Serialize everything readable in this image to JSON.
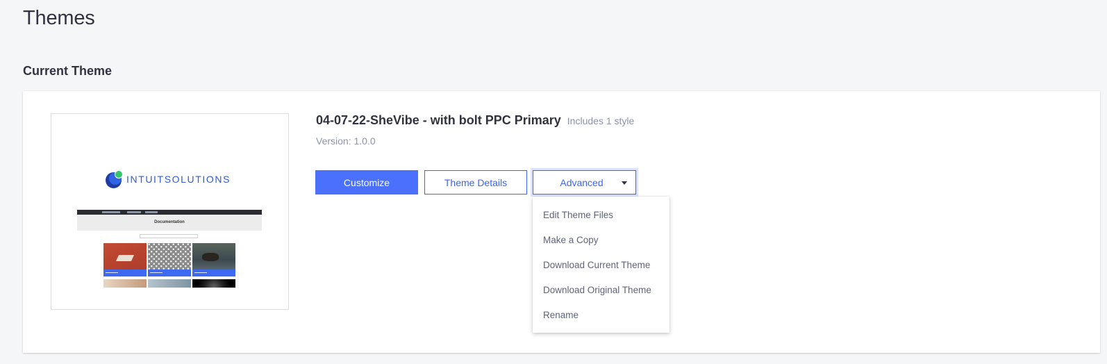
{
  "page": {
    "title": "Themes"
  },
  "current_section": {
    "title": "Current Theme"
  },
  "theme": {
    "name": "04-07-22-SheVibe - with bolt PPC Primary",
    "styles_note": "Includes 1 style",
    "version": "Version: 1.0.0",
    "preview": {
      "logo_text": "INTUITSOLUTIONS",
      "hero_text": "Documentation"
    }
  },
  "actions": {
    "customize_label": "Customize",
    "details_label": "Theme Details",
    "advanced_label": "Advanced"
  },
  "advanced_menu": {
    "items": [
      {
        "label": "Edit Theme Files"
      },
      {
        "label": "Make a Copy"
      },
      {
        "label": "Download Current Theme"
      },
      {
        "label": "Download Original Theme"
      },
      {
        "label": "Rename"
      }
    ]
  },
  "colors": {
    "primary": "#4b71fc",
    "outline": "#3c64f4",
    "background": "#f5f6f8"
  },
  "icons": {
    "dropdown": "caret-down-icon"
  }
}
